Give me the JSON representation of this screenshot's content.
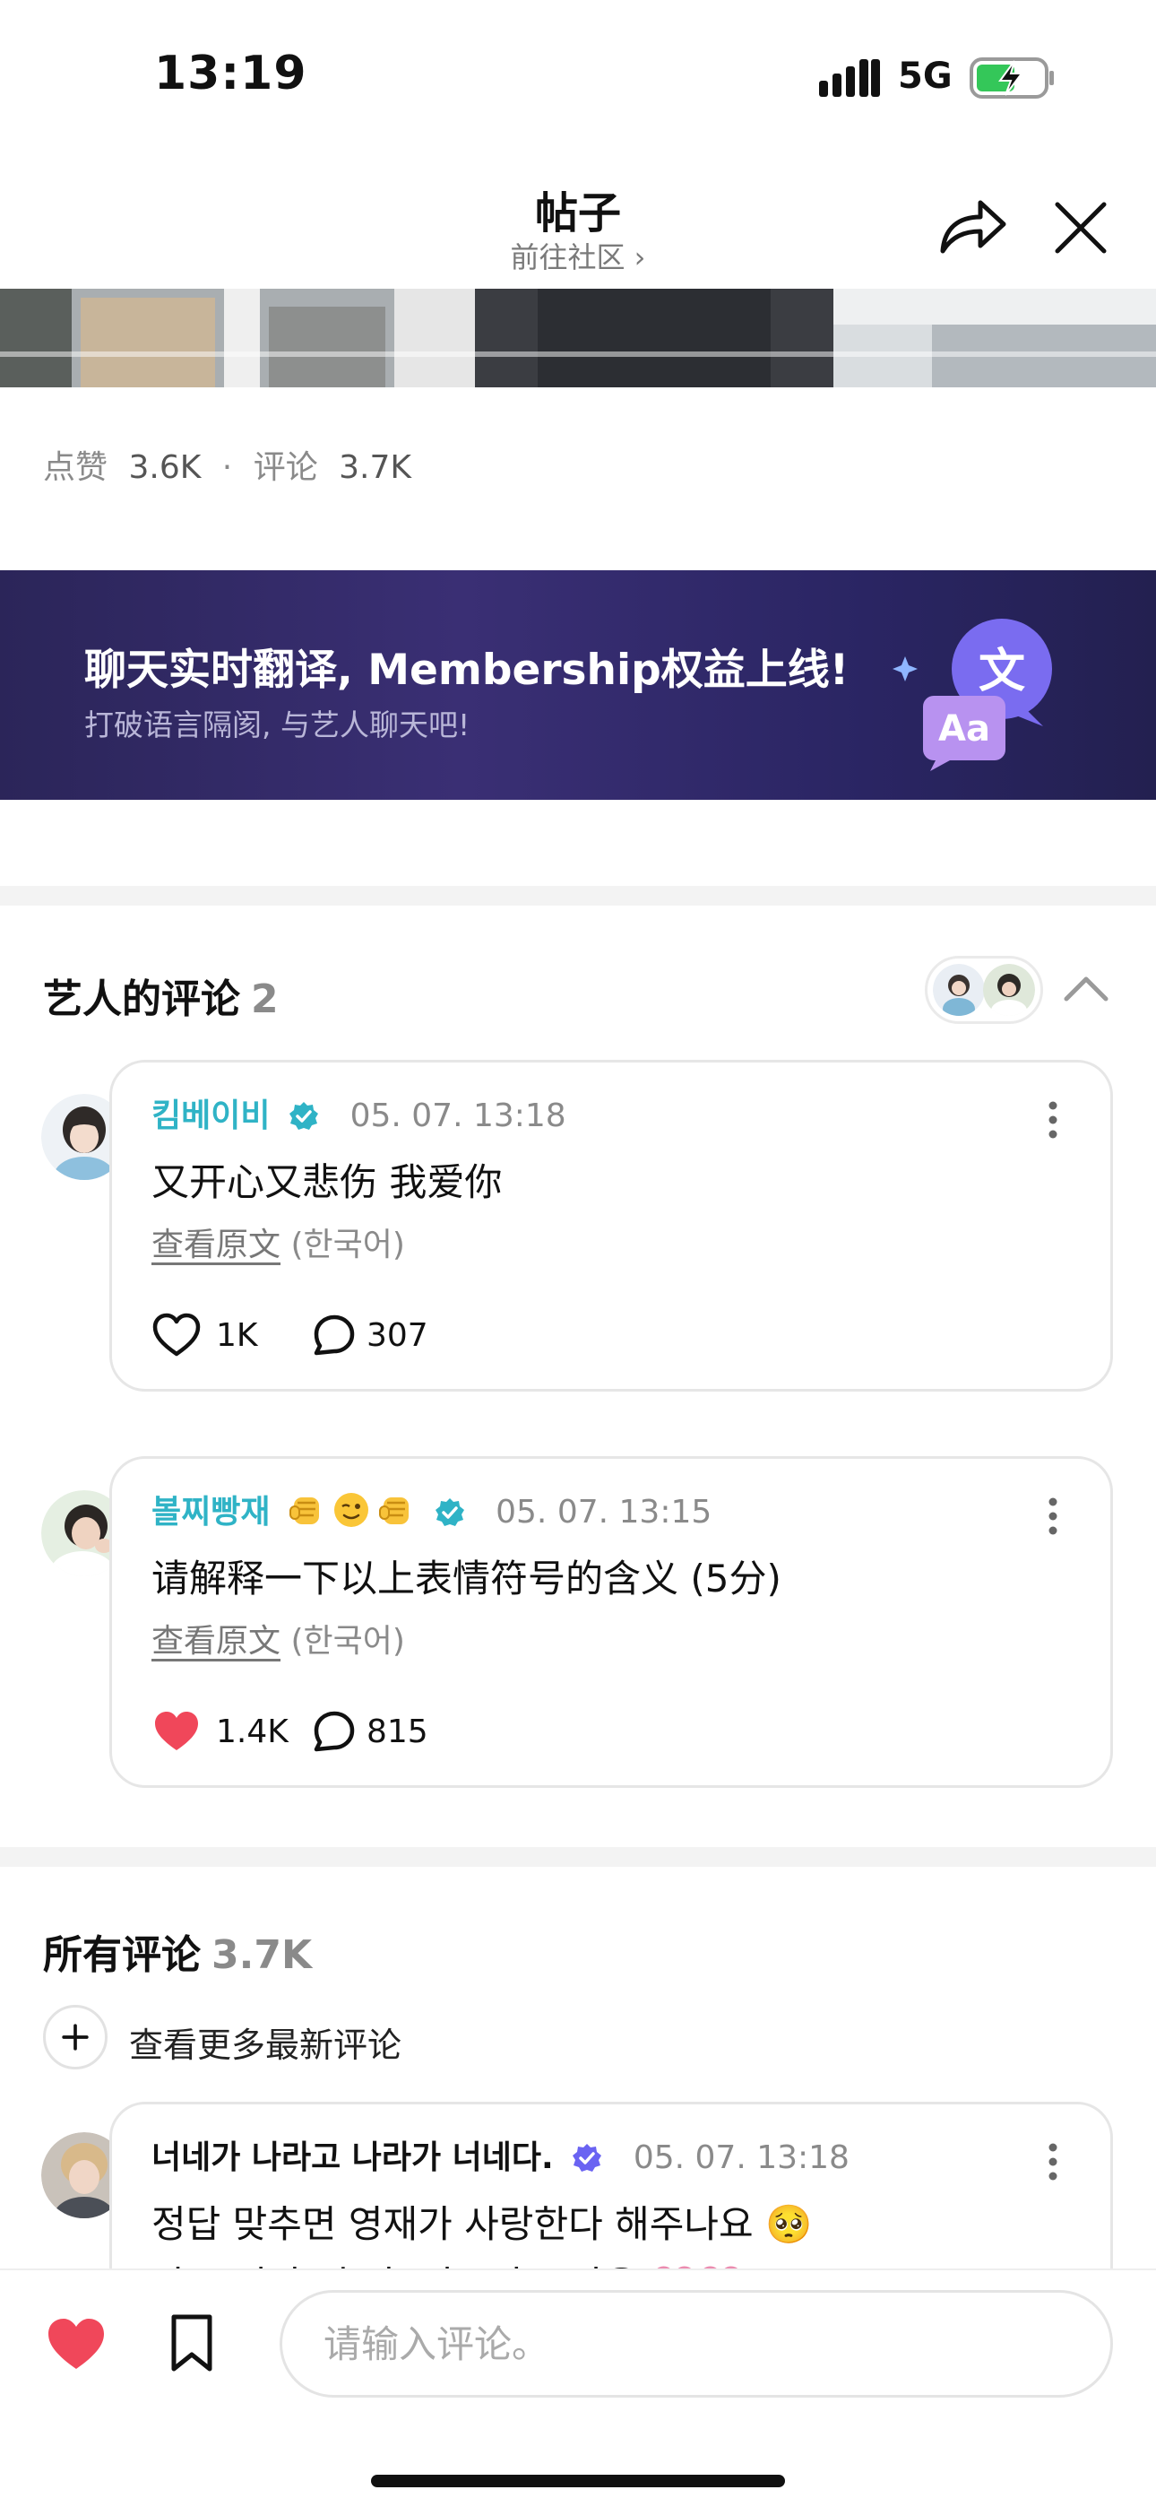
{
  "status_bar": {
    "time": "13:19",
    "network": "5G"
  },
  "header": {
    "title": "帖子",
    "subtitle": "前往社区 ›"
  },
  "stats": {
    "likes_label": "点赞",
    "likes_value": "3.6K",
    "separator": "·",
    "comments_label": "评论",
    "comments_value": "3.7K"
  },
  "banner": {
    "title": "聊天实时翻译, Membership权益上线!",
    "subtitle": "打破语言隔阂, 与艺人聊天吧!",
    "icon_glyph_top": "文",
    "icon_glyph_bottom": "Aa"
  },
  "artist_section": {
    "title": "艺人的评论",
    "count": "2"
  },
  "artist_comments": [
    {
      "name": "킴베이비",
      "time": "05. 07. 13:18",
      "text": "又开心又悲伤 我爱你",
      "original_link": "查看原文",
      "original_lang": "(한국어)",
      "likes": "1K",
      "replies": "307",
      "liked": false
    },
    {
      "name": "볼찌빵재",
      "time": "05. 07. 13:15",
      "text": "请解释一下以上表情符号的含义 (5分)",
      "original_link": "查看原文",
      "original_lang": "(한국어)",
      "likes": "1.4K",
      "replies": "815",
      "liked": true,
      "name_emojis": [
        "fist-emoji",
        "wink-emoji",
        "fist-emoji"
      ]
    }
  ],
  "all_section": {
    "title": "所有评论",
    "count": "3.7K",
    "more_new_label": "查看更多最新评论"
  },
  "all_comments": [
    {
      "name": "너네가 나라고 나라가 너네다.",
      "time": "05. 07. 13:18",
      "text": "정답 맞추면 영재가 사랑한다 해주나요 🥺",
      "text_line2": "아무 리빠. 슬퍼. 이쿠디오 마음 💗💗"
    }
  ],
  "bottom_bar": {
    "input_placeholder": "请输入评论。"
  },
  "colors": {
    "accent_cyan": "#2fb3c6",
    "like_red": "#f0475a",
    "banner_dark": "#2b2559"
  }
}
